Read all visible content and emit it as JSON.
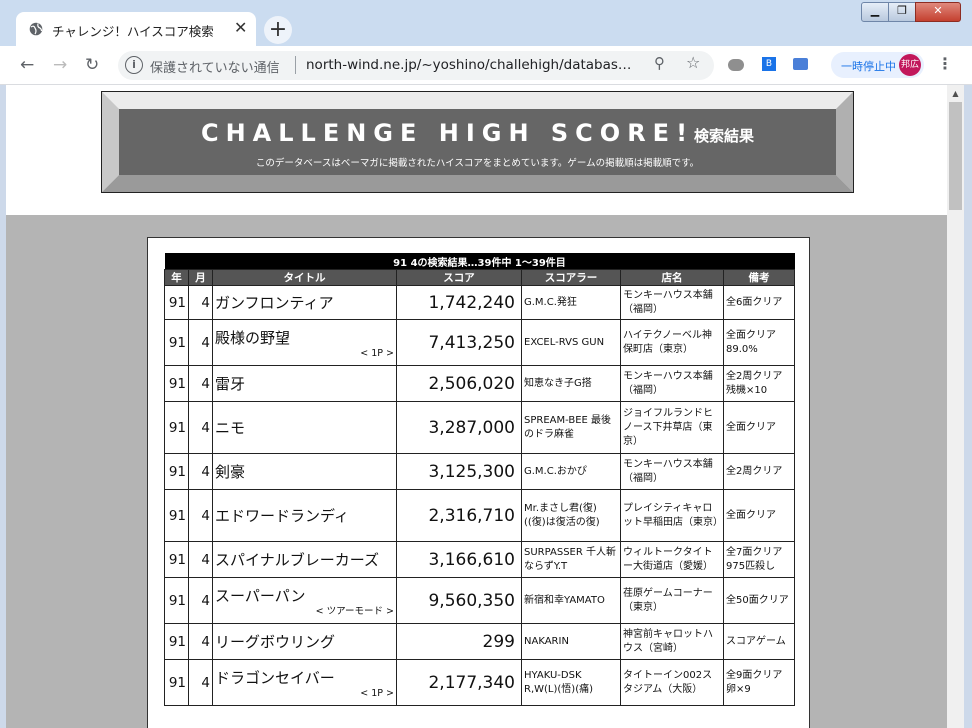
{
  "browser": {
    "tab_title": "チャレンジ！ハイスコア検索",
    "tab_close": "✕",
    "new_tab": "+",
    "window_buttons": {
      "minimize": "▁",
      "maximize": "❐",
      "close": "✕"
    },
    "nav": {
      "back": "←",
      "forward": "→",
      "reload": "↻"
    },
    "security_label": "保護されていない通信",
    "info_glyph": "i",
    "url": "north-wind.ne.jp/~yoshino/challehigh/databas…",
    "zoom_glyph": "⚲",
    "star_glyph": "☆",
    "pause_label": "一時停止中",
    "avatar_text": "邦広",
    "menu_glyph": "⋮",
    "ext_bookmark_text": "B"
  },
  "banner": {
    "title": "CHALLENGE HIGH SCORE!",
    "title_suffix": "検索結果",
    "description": "このデータベースはベーマガに掲載されたハイスコアをまとめています。ゲームの掲載順は掲載順です。"
  },
  "results": {
    "caption": "91 4の検索結果…39件中 1～39件目",
    "columns": [
      "年",
      "月",
      "タイトル",
      "スコア",
      "スコアラー",
      "店名",
      "備考"
    ],
    "rows": [
      {
        "year": "91",
        "month": "4",
        "title": "ガンフロンティア",
        "sub": "",
        "score": "1,742,240",
        "scorer": "G.M.C.発狂",
        "shop": "モンキーハウス本舗（福岡）",
        "note": "全6面クリア"
      },
      {
        "year": "91",
        "month": "4",
        "title": "殿様の野望",
        "sub": "< 1P >",
        "score": "7,413,250",
        "scorer": "EXCEL-RVS GUN",
        "shop": "ハイテクノーベル神保町店（東京）",
        "note": "全面クリア 89.0%"
      },
      {
        "year": "91",
        "month": "4",
        "title": "雷牙",
        "sub": "",
        "score": "2,506,020",
        "scorer": "知恵なき子G搭",
        "shop": "モンキーハウス本舗（福岡）",
        "note": "全2周クリア 残機×10"
      },
      {
        "year": "91",
        "month": "4",
        "title": "ニモ",
        "sub": "",
        "score": "3,287,000",
        "scorer": "SPREAM-BEE 最後のドラ麻雀",
        "shop": "ジョイフルランドヒノース下井草店（東京）",
        "note": "全面クリア"
      },
      {
        "year": "91",
        "month": "4",
        "title": "剣豪",
        "sub": "",
        "score": "3,125,300",
        "scorer": "G.M.C.おかぴ",
        "shop": "モンキーハウス本舗（福岡）",
        "note": "全2周クリア"
      },
      {
        "year": "91",
        "month": "4",
        "title": "エドワードランディ",
        "sub": "",
        "score": "2,316,710",
        "scorer": "Mr.まさし君(復)((復)は復活の復)",
        "shop": "プレイシティキャロット早稲田店（東京）",
        "note": "全面クリア"
      },
      {
        "year": "91",
        "month": "4",
        "title": "スパイナルブレーカーズ",
        "sub": "",
        "score": "3,166,610",
        "scorer": "SURPASSER 千人斬ならずY.T",
        "shop": "ウィルトークタイトー大街道店（愛媛）",
        "note": "全7面クリア 975匹殺し"
      },
      {
        "year": "91",
        "month": "4",
        "title": "スーパーパン",
        "sub": "< ツアーモード >",
        "score": "9,560,350",
        "scorer": "新宿和幸YAMATO",
        "shop": "荏原ゲームコーナー（東京）",
        "note": "全50面クリア"
      },
      {
        "year": "91",
        "month": "4",
        "title": "リーグボウリング",
        "sub": "",
        "score": "299",
        "scorer": "NAKARIN",
        "shop": "神宮前キャロットハウス（宮崎）",
        "note": "スコアゲーム"
      },
      {
        "year": "91",
        "month": "4",
        "title": "ドラゴンセイバー",
        "sub": "< 1P >",
        "score": "2,177,340",
        "scorer": "HYAKU-DSK R,W(L)(悟)(痛)",
        "shop": "タイトーイン002スタジアム（大阪）",
        "note": "全9面クリア 卵×9"
      }
    ]
  }
}
